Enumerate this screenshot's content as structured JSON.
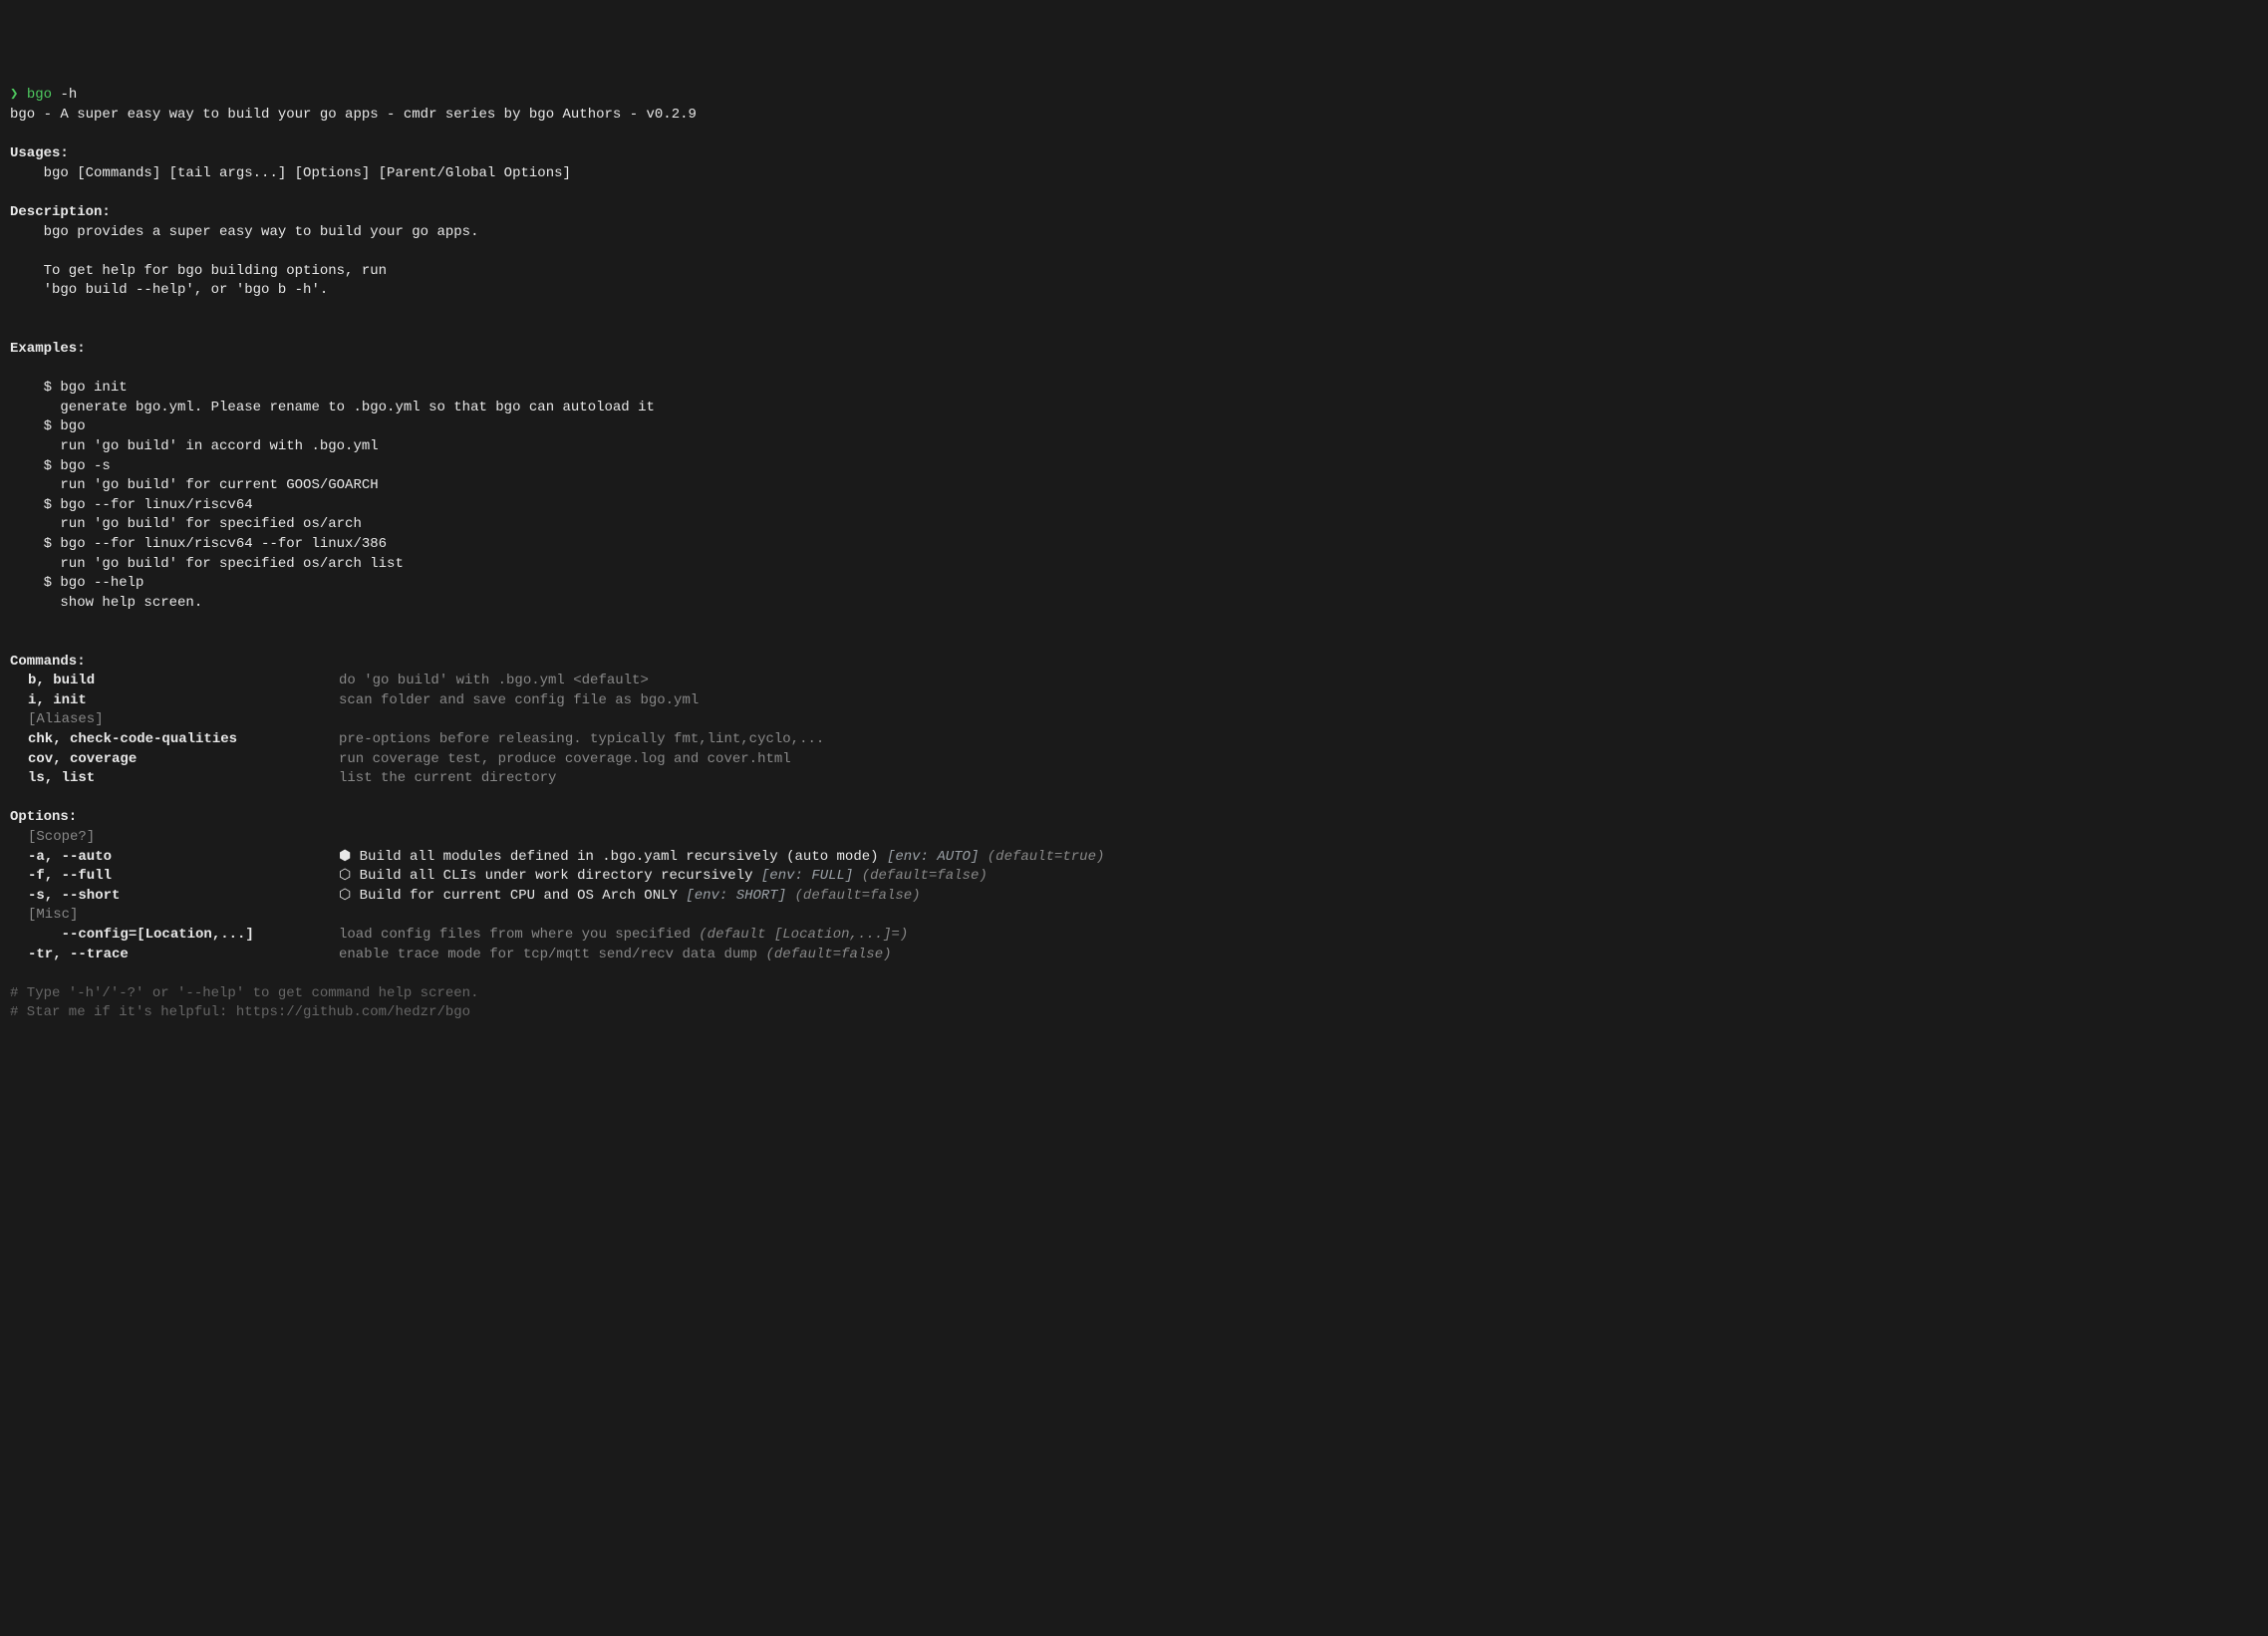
{
  "prompt": {
    "char": "❯",
    "command": "bgo",
    "arg": "-h"
  },
  "title_line": "bgo - A super easy way to build your go apps - cmdr series by bgo Authors - v0.2.9",
  "usages": {
    "header": "Usages:",
    "line": "    bgo [Commands] [tail args...] [Options] [Parent/Global Options]"
  },
  "description": {
    "header": "Description:",
    "lines": [
      "    bgo provides a super easy way to build your go apps.",
      "",
      "    To get help for bgo building options, run",
      "    'bgo build --help', or 'bgo b -h'."
    ]
  },
  "examples": {
    "header": "Examples:",
    "items": [
      {
        "cmd": "    $ bgo init",
        "desc": "      generate bgo.yml. Please rename to .bgo.yml so that bgo can autoload it"
      },
      {
        "cmd": "    $ bgo",
        "desc": "      run 'go build' in accord with .bgo.yml"
      },
      {
        "cmd": "    $ bgo -s",
        "desc": "      run 'go build' for current GOOS/GOARCH"
      },
      {
        "cmd": "    $ bgo --for linux/riscv64",
        "desc": "      run 'go build' for specified os/arch"
      },
      {
        "cmd": "    $ bgo --for linux/riscv64 --for linux/386",
        "desc": "      run 'go build' for specified os/arch list"
      },
      {
        "cmd": "    $ bgo --help",
        "desc": "      show help screen."
      }
    ]
  },
  "commands": {
    "header": "Commands:",
    "rows": [
      {
        "key": "b, build",
        "desc": "do 'go build' with .bgo.yml <default>"
      },
      {
        "key": "i, init",
        "desc": "scan folder and save config file as bgo.yml"
      }
    ],
    "aliases_label": "[Aliases]",
    "alias_rows": [
      {
        "key": "chk, check-code-qualities",
        "desc": "pre-options before releasing. typically fmt,lint,cyclo,..."
      },
      {
        "key": "cov, coverage",
        "desc": "run coverage test, produce coverage.log and cover.html"
      },
      {
        "key": "ls, list",
        "desc": "list the current directory"
      }
    ]
  },
  "options": {
    "header": "Options:",
    "scope_label": "[Scope?]",
    "scope_rows": [
      {
        "key": "-a, --auto",
        "icon": "⬢",
        "desc": "Build all modules defined in .bgo.yaml recursively (auto mode) ",
        "env": "[env: AUTO]",
        "default": " (default=true)"
      },
      {
        "key": "-f, --full",
        "icon": "⬡",
        "desc": "Build all CLIs under work directory recursively ",
        "env": "[env: FULL]",
        "default": " (default=false)"
      },
      {
        "key": "-s, --short",
        "icon": "⬡",
        "desc": "Build for current CPU and OS Arch ONLY ",
        "env": "[env: SHORT]",
        "default": " (default=false)"
      }
    ],
    "misc_label": "[Misc]",
    "misc_rows": [
      {
        "key": "    --config=[Location,...]",
        "desc": "load config files from where you specified ",
        "default_italic": "(default [Location,...]=)"
      },
      {
        "key": "-tr, --trace",
        "desc": "enable trace mode for tcp/mqtt send/recv data dump ",
        "default_italic": "(default=false)"
      }
    ]
  },
  "footer": [
    "# Type '-h'/'-?' or '--help' to get command help screen.",
    "# Star me if it's helpful: https://github.com/hedzr/bgo"
  ]
}
